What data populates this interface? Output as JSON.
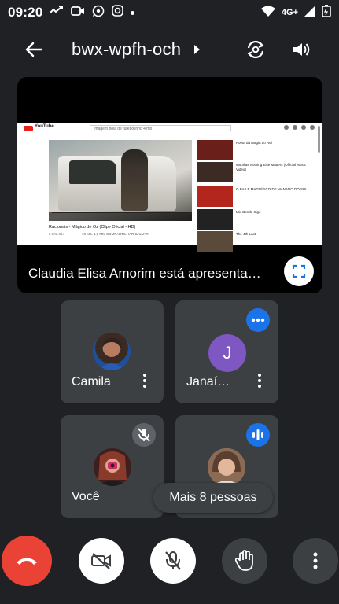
{
  "status_bar": {
    "time": "09:20",
    "network": "4G+",
    "notification_icons": [
      "missed-call-icon",
      "video-icon",
      "whatsapp-icon",
      "instagram-icon",
      "dot-icon"
    ],
    "system_icons": [
      "wifi-icon",
      "signal-icon",
      "battery-icon"
    ]
  },
  "top_bar": {
    "meeting_code": "bwx-wpfh-och"
  },
  "presentation": {
    "caption": "Claudia Elisa Amorim está apresenta…",
    "shared_screen": {
      "search_placeholder": "Imagem bola de futebolinho 4 mb",
      "logo_text": "YouTube",
      "video_title": "Racionais - Mágico de Oz (Clipe Oficial - HD)",
      "video_date": "5.002.014",
      "video_actions": "10 MIL   1,6 MIL   COMPARTILHAR   SALVAR",
      "suggestions": [
        {
          "title": "Poeta da Magia do Rei",
          "thumb_color": "#6b1f1a"
        },
        {
          "title": "Mobilias Nothing Else Matters (Official Music Video)",
          "thumb_color": "#3c2a24"
        },
        {
          "title": "O BAILE MAGNÍFICO DE MANANO DO SUL",
          "thumb_color": "#b3261e"
        },
        {
          "title": "Mix Bonde Sigo",
          "thumb_color": "#222222"
        },
        {
          "title": "The 4th Last",
          "thumb_color": "#5a4a3a"
        }
      ]
    }
  },
  "participants": [
    {
      "name": "Camila",
      "kind": "photo",
      "status": "none"
    },
    {
      "name": "Janaí…",
      "initial": "J",
      "kind": "letter",
      "status": "speaking"
    },
    {
      "name": "Você",
      "kind": "photo",
      "status": "muted"
    },
    {
      "name": "",
      "kind": "photo",
      "status": "speaking"
    }
  ],
  "more_people_label": "Mais 8 pessoas",
  "colors": {
    "end_call": "#ea4335",
    "speaking_badge": "#1a73e8",
    "avatar_letter_bg": "#7e57c2",
    "background": "#202124",
    "tile": "#3c4043"
  }
}
